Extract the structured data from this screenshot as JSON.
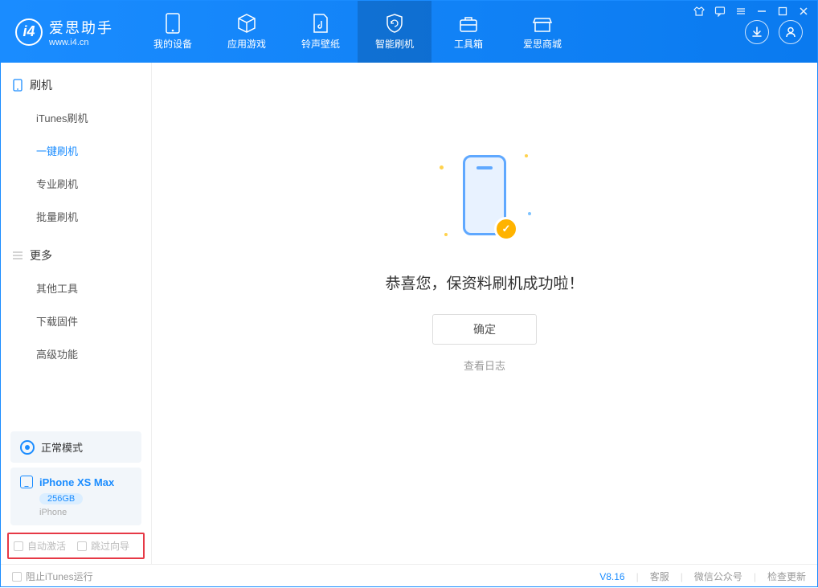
{
  "app": {
    "name": "爱思助手",
    "url": "www.i4.cn"
  },
  "nav": {
    "items": [
      {
        "label": "我的设备"
      },
      {
        "label": "应用游戏"
      },
      {
        "label": "铃声壁纸"
      },
      {
        "label": "智能刷机"
      },
      {
        "label": "工具箱"
      },
      {
        "label": "爱思商城"
      }
    ]
  },
  "sidebar": {
    "group1": {
      "title": "刷机"
    },
    "items1": [
      {
        "label": "iTunes刷机"
      },
      {
        "label": "一键刷机"
      },
      {
        "label": "专业刷机"
      },
      {
        "label": "批量刷机"
      }
    ],
    "group2": {
      "title": "更多"
    },
    "items2": [
      {
        "label": "其他工具"
      },
      {
        "label": "下载固件"
      },
      {
        "label": "高级功能"
      }
    ],
    "mode": "正常模式",
    "device": {
      "name": "iPhone XS Max",
      "capacity": "256GB",
      "type": "iPhone"
    },
    "opts": {
      "auto_activate": "自动激活",
      "skip_guide": "跳过向导"
    }
  },
  "main": {
    "success_msg": "恭喜您，保资料刷机成功啦！",
    "ok": "确定",
    "view_log": "查看日志"
  },
  "footer": {
    "block_itunes": "阻止iTunes运行",
    "version": "V8.16",
    "support": "客服",
    "wechat": "微信公众号",
    "check_update": "检查更新"
  }
}
